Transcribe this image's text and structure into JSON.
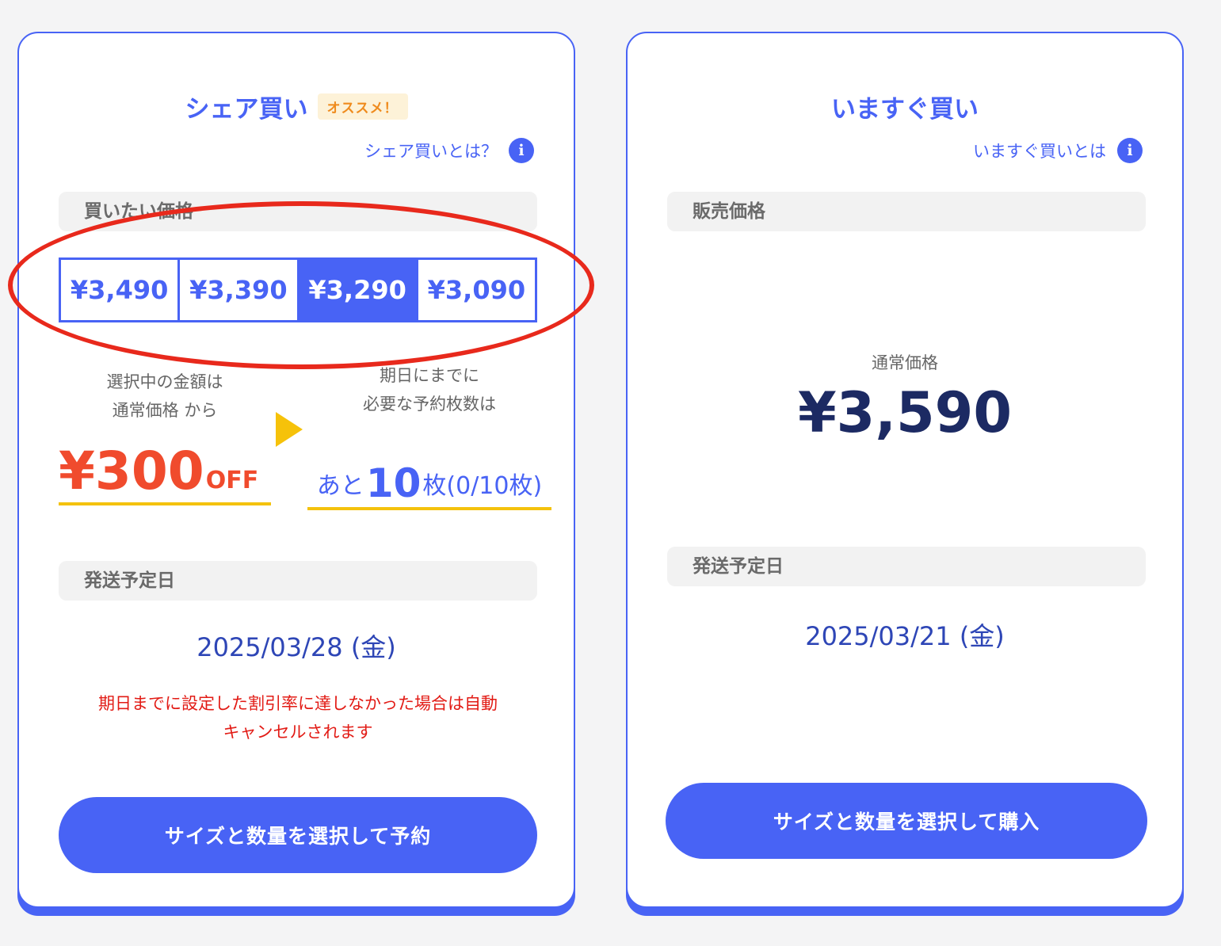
{
  "share": {
    "title": "シェア買い",
    "badge": "オススメ！",
    "info_link": "シェア買いとは？",
    "info_icon": "i",
    "price_section": "買いたい価格",
    "prices": [
      {
        "label": "¥3,490",
        "selected": false
      },
      {
        "label": "¥3,390",
        "selected": false
      },
      {
        "label": "¥3,290",
        "selected": true
      },
      {
        "label": "¥3,090",
        "selected": false
      }
    ],
    "discount_caption_1": "選択中の金額は",
    "discount_caption_2": "通常価格 から",
    "discount_amount": "¥300",
    "discount_off": "OFF",
    "needed_caption_1": "期日にまでに",
    "needed_caption_2": "必要な予約枚数は",
    "remaining_prefix": "あと",
    "remaining_count": "10",
    "remaining_suffix": "枚(0/10枚)",
    "ship_section": "発送予定日",
    "ship_date": "2025/03/28 (金)",
    "warning_1": "期日までに設定した割引率に達しなかった場合は自動",
    "warning_2": "キャンセルされます",
    "button": "サイズと数量を選択して予約"
  },
  "now": {
    "title": "いますぐ買い",
    "info_link": "いますぐ買いとは",
    "info_icon": "i",
    "price_section": "販売価格",
    "normal_label": "通常価格",
    "normal_price": "¥3,590",
    "ship_section": "発送予定日",
    "ship_date": "2025/03/21 (金)",
    "button": "サイズと数量を選択して購入"
  },
  "colors": {
    "accent": "#4863f5",
    "discount": "#f04b2d",
    "underline": "#f4c20d",
    "warning": "#e21b15",
    "highlight_ring": "#e8291c"
  }
}
